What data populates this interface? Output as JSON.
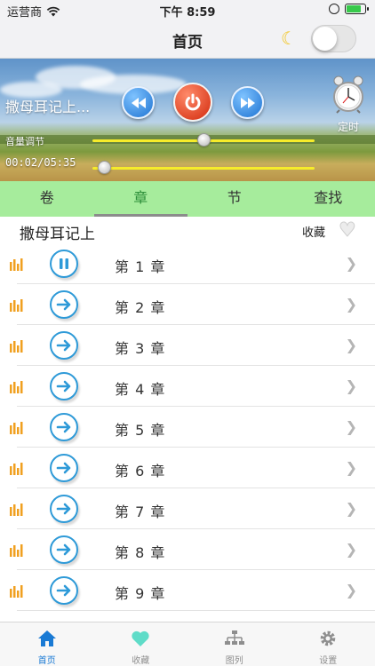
{
  "status_bar": {
    "carrier": "运营商",
    "time": "下午 8:59",
    "icons": [
      "wifi-icon",
      "battery-icon"
    ],
    "battery_color": "#37c94b"
  },
  "nav": {
    "title": "首页",
    "night_mode_icon": "moon-icon",
    "toggle_on": false
  },
  "player": {
    "title": "撒母耳记上...",
    "volume_label": "音量调节",
    "volume_level": 0.5,
    "elapsed": "00:02",
    "duration": "05:35",
    "time_display": "00:02/05:35",
    "progress": 0.006,
    "timer_label": "定时",
    "controls": [
      "rewind-icon",
      "power-icon",
      "fast-forward-icon",
      "alarm-clock-icon"
    ],
    "slider_color": "#f6ec2a"
  },
  "tabs": [
    {
      "label": "卷",
      "active": false
    },
    {
      "label": "章",
      "active": true
    },
    {
      "label": "节",
      "active": false
    },
    {
      "label": "查找",
      "active": false
    }
  ],
  "section": {
    "book_title": "撒母耳记上",
    "favorite_label": "收藏",
    "favorite_icon": "heart-icon"
  },
  "chapters": [
    {
      "label": "第 1 章",
      "state": "playing"
    },
    {
      "label": "第 2 章",
      "state": "idle"
    },
    {
      "label": "第 3 章",
      "state": "idle"
    },
    {
      "label": "第 4 章",
      "state": "idle"
    },
    {
      "label": "第 5 章",
      "state": "idle"
    },
    {
      "label": "第 6 章",
      "state": "idle"
    },
    {
      "label": "第 7 章",
      "state": "idle"
    },
    {
      "label": "第 8 章",
      "state": "idle"
    },
    {
      "label": "第 9 章",
      "state": "idle"
    }
  ],
  "tab_bar": [
    {
      "label": "首页",
      "icon": "home-icon",
      "active": true
    },
    {
      "label": "收藏",
      "icon": "heart-icon",
      "active": false
    },
    {
      "label": "图列",
      "icon": "tree-diagram-icon",
      "active": false
    },
    {
      "label": "设置",
      "icon": "gear-icon",
      "active": false
    }
  ],
  "colors": {
    "accent_blue": "#1a7ad4",
    "tab_green": "#a6ec9c",
    "active_tab_text": "#2d8f3a",
    "bars_orange": "#f0a020"
  }
}
